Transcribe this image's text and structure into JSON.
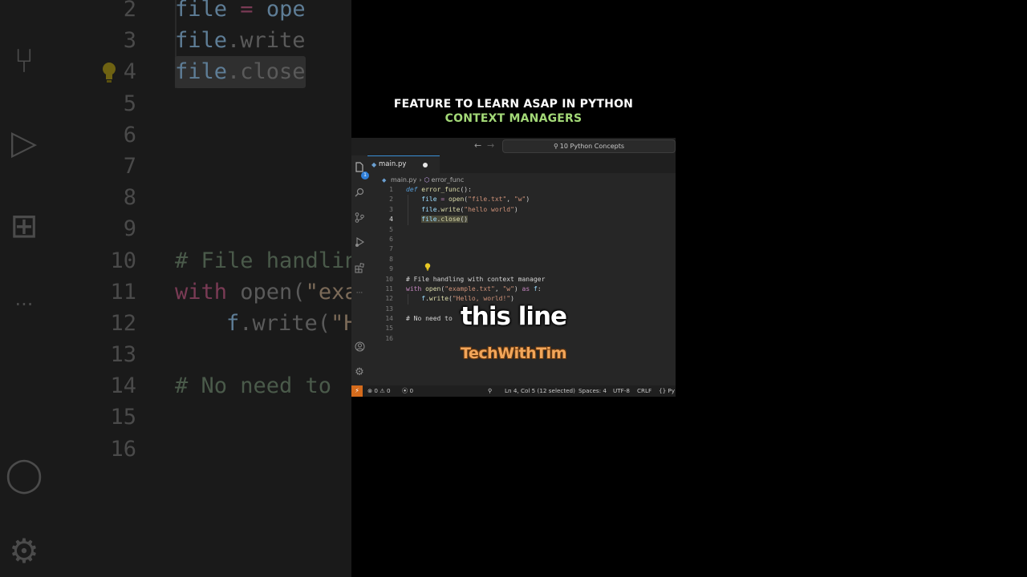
{
  "headline": {
    "line1": "FEATURE TO LEARN ASAP IN PYTHON",
    "line2": "CONTEXT MANAGERS"
  },
  "titlebar": {
    "back": "←",
    "forward": "→",
    "search": "10 Python Concepts"
  },
  "activity_bar": {
    "explorer_badge": "1",
    "more": "···"
  },
  "tab": {
    "label": "main.py"
  },
  "breadcrumb": {
    "file": "main.py",
    "symbol": "error_func"
  },
  "code": {
    "line_numbers": [
      "1",
      "2",
      "3",
      "4",
      "5",
      "6",
      "7",
      "8",
      "9",
      "10",
      "11",
      "12",
      "13",
      "14",
      "15",
      "16"
    ],
    "active_line": "4"
  },
  "background": {
    "line_numbers": [
      "2",
      "3",
      "4",
      "5",
      "6",
      "7",
      "8",
      "9",
      "10",
      "11",
      "12",
      "13",
      "14",
      "15",
      "16"
    ]
  },
  "statusbar": {
    "errors": "0",
    "warnings": "0",
    "ports": "0",
    "position": "Ln 4, Col 5 (12 selected)",
    "spaces": "Spaces: 4",
    "encoding": "UTF-8",
    "eol": "CRLF",
    "language": "{} Py"
  },
  "overlay": {
    "caption": "this line",
    "brand": "TechWithTim"
  },
  "colors": {
    "headline_accent": "#a3d977",
    "brand": "#f2a65a",
    "remote_indicator": "#d56b1c"
  }
}
